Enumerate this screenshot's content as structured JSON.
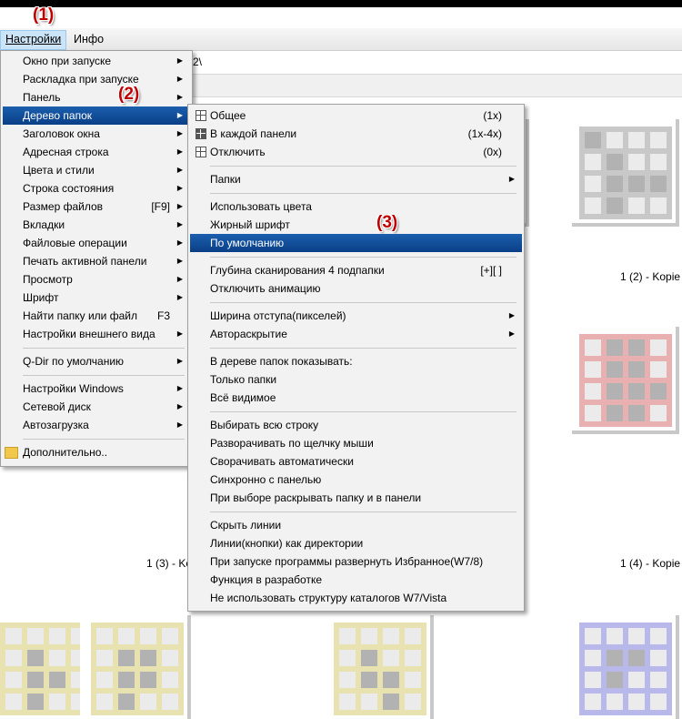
{
  "menubar": {
    "items": [
      "Настройки",
      "Инфо"
    ]
  },
  "annotations": [
    "(1)",
    "(2)",
    "(3)"
  ],
  "address": {
    "text": "2\\"
  },
  "thumbnails": [
    {
      "color": "#c8c8ea"
    },
    {
      "color": "#c8c8c8"
    },
    {
      "color": "#b8e4b8"
    },
    {
      "color": "#e8b0b0"
    },
    {
      "color": "#e8e2b0"
    },
    {
      "color": "#e8e2b0"
    },
    {
      "color": "#e8e2b0"
    },
    {
      "color": "#b8b8ea"
    }
  ],
  "captions": [
    "1 (2) - Kopie",
    "1 (3) - Ko",
    "1 (4) - Kopie"
  ],
  "main_menu": [
    {
      "label": "Окно при запуске",
      "arrow": true
    },
    {
      "label": "Раскладка при запуске",
      "arrow": true
    },
    {
      "label": "Панель",
      "arrow": true
    },
    {
      "label": "Дерево папок",
      "arrow": true
    },
    {
      "label": "Заголовок окна",
      "arrow": true
    },
    {
      "label": "Адресная строка",
      "arrow": true
    },
    {
      "label": "Цвета и стили",
      "arrow": true
    },
    {
      "label": "Строка состояния",
      "arrow": true
    },
    {
      "label": "Размер файлов",
      "shortcut": "[F9]",
      "arrow": true
    },
    {
      "label": "Вкладки",
      "arrow": true
    },
    {
      "label": "Файловые операции",
      "arrow": true
    },
    {
      "label": "Печать активной панели",
      "arrow": true
    },
    {
      "label": "Просмотр",
      "arrow": true
    },
    {
      "label": "Шрифт",
      "arrow": true
    },
    {
      "label": "Найти папку или файл",
      "shortcut": "F3"
    },
    {
      "label": "Настройки внешнего вида",
      "arrow": true
    },
    {
      "label": "Q-Dir по умолчанию",
      "arrow": true
    },
    {
      "label": "Настройки Windows",
      "arrow": true
    },
    {
      "label": "Сетевой диск",
      "arrow": true
    },
    {
      "label": "Автозагрузка",
      "arrow": true
    },
    {
      "label": "Дополнительно.."
    }
  ],
  "sub_menu": [
    {
      "label": "Общее",
      "shortcut": "(1x)"
    },
    {
      "label": "В каждой панели",
      "shortcut": "(1x-4x)"
    },
    {
      "label": "Отключить",
      "shortcut": "(0x)"
    },
    {
      "label": "Папки",
      "arrow": true
    },
    {
      "label": "Использовать цвета"
    },
    {
      "label": "Жирный шрифт"
    },
    {
      "label": "По умолчанию"
    },
    {
      "label": "Глубина сканирования 4 подпапки",
      "shortcut": "[+][ ]"
    },
    {
      "label": "Отключить анимацию"
    },
    {
      "label": "Ширина отступа(пикселей)",
      "arrow": true
    },
    {
      "label": "Автораскрытие",
      "arrow": true
    },
    {
      "label": "В дереве папок показывать:"
    },
    {
      "label": "Только папки"
    },
    {
      "label": "Всё видимое"
    },
    {
      "label": "Выбирать всю строку"
    },
    {
      "label": "Разворачивать по щелчку мыши"
    },
    {
      "label": "Сворачивать автоматически"
    },
    {
      "label": "Синхронно с панелью"
    },
    {
      "label": "При выборе раскрывать папку и в панели"
    },
    {
      "label": "Скрыть линии"
    },
    {
      "label": "Линии(кнопки) как директории"
    },
    {
      "label": "При запуске программы развернуть Избранное(W7/8)"
    },
    {
      "label": "Функция в разработке"
    },
    {
      "label": "Не использовать структуру каталогов W7/Vista"
    }
  ],
  "arrow_glyph": "▶"
}
